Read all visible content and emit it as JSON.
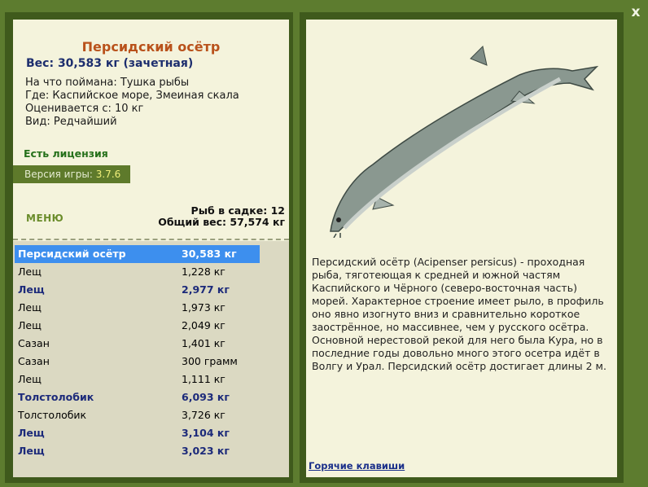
{
  "close_label": "x",
  "fish": {
    "title": "Персидский осётр",
    "weight": "Вес: 30,583 кг (зачетная)",
    "caught_on": "На что поймана: Тушка рыбы",
    "where": "Где: Каспийское море, Змеиная скала",
    "rated_from": "Оценивается с: 10 кг",
    "kind": "Вид: Редчайший"
  },
  "license": "Есть лицензия",
  "version": {
    "label": "Версия игры:",
    "value": "3.7.6"
  },
  "menu_label": "МЕНЮ",
  "cage": {
    "count": "Рыб в садке: 12",
    "total": "Общий вес: 57,574 кг"
  },
  "catch_list": [
    {
      "name": "Персидский осётр",
      "weight": "30,583 кг"
    },
    {
      "name": "Лещ",
      "weight": "1,228 кг"
    },
    {
      "name": "Лещ",
      "weight": "2,977 кг"
    },
    {
      "name": "Лещ",
      "weight": "1,973 кг"
    },
    {
      "name": "Лещ",
      "weight": "2,049 кг"
    },
    {
      "name": "Сазан",
      "weight": "1,401 кг"
    },
    {
      "name": "Сазан",
      "weight": "300 грамм"
    },
    {
      "name": "Лещ",
      "weight": "1,111 кг"
    },
    {
      "name": "Толстолобик",
      "weight": "6,093 кг"
    },
    {
      "name": "Толстолобик",
      "weight": "3,726 кг"
    },
    {
      "name": "Лещ",
      "weight": "3,104 кг"
    },
    {
      "name": "Лещ",
      "weight": "3,023 кг"
    }
  ],
  "description": "Персидский осётр (Acipenser persicus) - проходная рыба, тяготеющая к средней и южной частям Каспийского и Чёрного (северо-восточная часть) морей. Характерное строение имеет рыло, в профиль оно явно изогнуто вниз и сравнительно короткое заострённое, но массивнее, чем у русского осётра. Основной нерестовой рекой для него была Кура, но в последние годы довольно много этого осетра идёт в Волгу и Урал. Персидский осётр достигает длины 2 м.",
  "hotkeys_label": "Горячие клавиши",
  "colors": {
    "background": "#5d7c2f",
    "panel": "#f4f3dc",
    "selected": "#3d8fee",
    "title": "#b9521b"
  }
}
